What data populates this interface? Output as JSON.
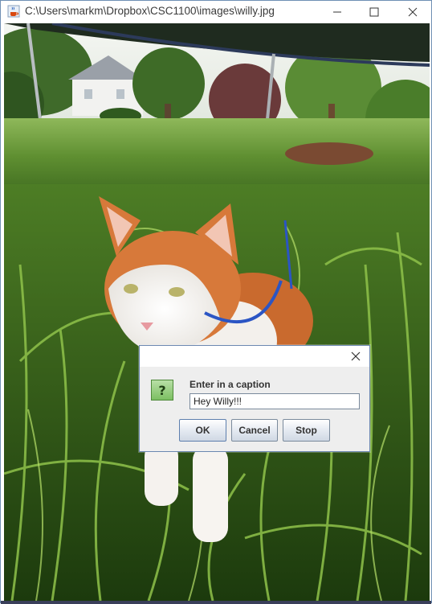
{
  "window": {
    "title": "C:\\Users\\markm\\Dropbox\\CSC1100\\images\\willy.jpg",
    "icon": "java-coffee-cup-icon",
    "controls": [
      "minimize-icon",
      "maximize-icon",
      "close-icon"
    ]
  },
  "image": {
    "subject": "orange-and-white cat sitting in tall grass"
  },
  "dialog": {
    "icon": "question-icon",
    "question_glyph": "?",
    "prompt": "Enter in a caption",
    "input_value": "Hey Willy!!!",
    "buttons": {
      "ok": "OK",
      "cancel": "Cancel",
      "stop": "Stop"
    }
  },
  "colors": {
    "window_border": "#6f8fb4",
    "dialog_bg": "#eeeeee",
    "question_icon_green": "#7cbf62"
  }
}
